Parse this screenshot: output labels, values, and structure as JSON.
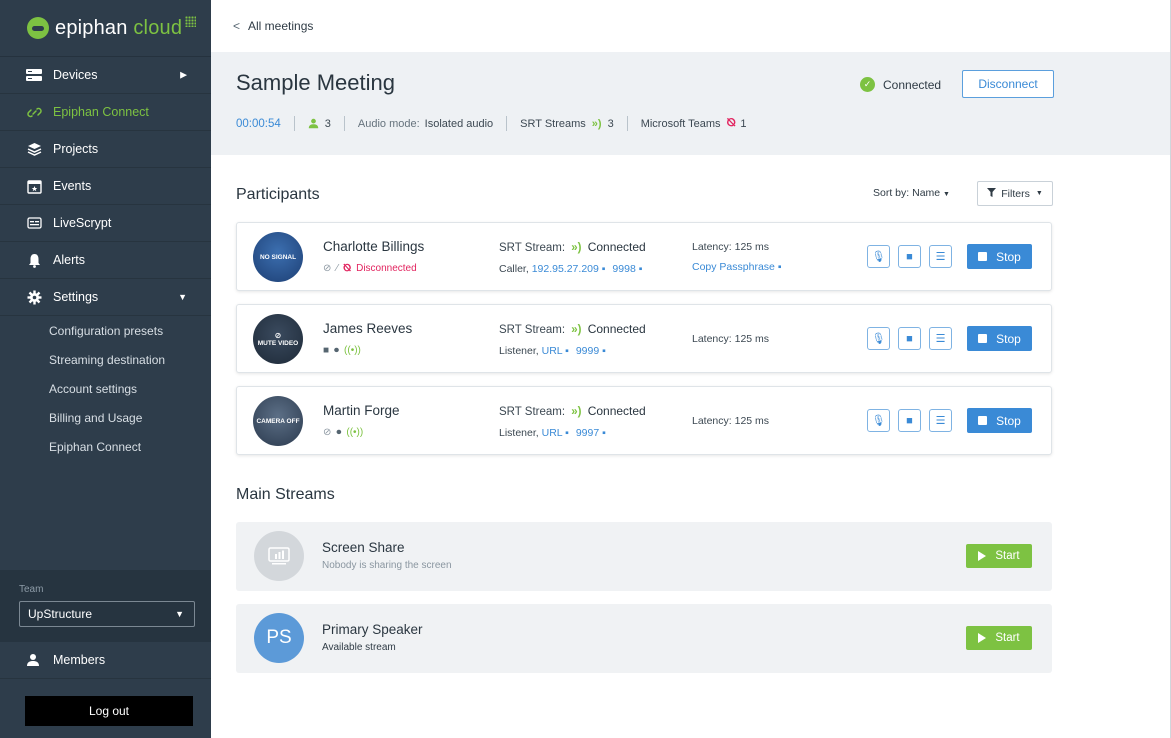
{
  "brand": {
    "name_main": "epiphan",
    "name_accent": "cloud"
  },
  "sidebar": {
    "items": [
      {
        "label": "Devices",
        "icon": "devices-icon"
      },
      {
        "label": "Epiphan Connect",
        "icon": "link-icon"
      },
      {
        "label": "Projects",
        "icon": "layers-icon"
      },
      {
        "label": "Events",
        "icon": "calendar-star-icon"
      },
      {
        "label": "LiveScrypt",
        "icon": "captions-icon"
      },
      {
        "label": "Alerts",
        "icon": "bell-icon"
      },
      {
        "label": "Settings",
        "icon": "gear-icon"
      }
    ],
    "settings_sub": [
      "Configuration presets",
      "Streaming destination",
      "Account settings",
      "Billing and Usage",
      "Epiphan Connect"
    ],
    "team_label": "Team",
    "team_value": "UpStructure",
    "members_label": "Members",
    "logout_label": "Log out"
  },
  "topbar": {
    "back_label": "All meetings"
  },
  "meeting": {
    "title": "Sample Meeting",
    "status": "Connected",
    "disconnect_label": "Disconnect",
    "timer": "00:00:54",
    "participants_count": "3",
    "audio_mode_label": "Audio mode:",
    "audio_mode_value": "Isolated audio",
    "srt_label": "SRT Streams",
    "srt_count": "3",
    "teams_label": "Microsoft Teams",
    "teams_count": "1"
  },
  "participants_section": {
    "title": "Participants",
    "sort_label": "Sort by:",
    "sort_value": "Name",
    "filters_label": "Filters"
  },
  "participants": [
    {
      "name": "Charlotte Billings",
      "avatar_text": "NO SIGNAL",
      "teams_status": "Disconnected",
      "srt_label": "SRT Stream:",
      "srt_status": "Connected",
      "mode": "Caller,",
      "address": "192.95.27.209",
      "port": "9998",
      "latency_label": "Latency:",
      "latency": "125 ms",
      "copy_passphrase": "Copy Passphrase",
      "stop_label": "Stop"
    },
    {
      "name": "James Reeves",
      "avatar_text": "MUTE VIDEO",
      "srt_label": "SRT Stream:",
      "srt_status": "Connected",
      "mode": "Listener,",
      "address": "URL",
      "port": "9999",
      "latency_label": "Latency:",
      "latency": "125 ms",
      "stop_label": "Stop"
    },
    {
      "name": "Martin Forge",
      "avatar_text": "CAMERA OFF",
      "srt_label": "SRT Stream:",
      "srt_status": "Connected",
      "mode": "Listener,",
      "address": "URL",
      "port": "9997",
      "latency_label": "Latency:",
      "latency": "125 ms",
      "stop_label": "Stop"
    }
  ],
  "main_streams": {
    "title": "Main Streams",
    "items": [
      {
        "title": "Screen Share",
        "subtitle": "Nobody is sharing the screen",
        "start_label": "Start"
      },
      {
        "title": "Primary Speaker",
        "subtitle": "Available stream",
        "avatar_text": "PS",
        "start_label": "Start"
      }
    ]
  },
  "colors": {
    "sidebar": "#2e3d4b",
    "accent_green": "#7dc242",
    "accent_blue": "#3a8ad6",
    "alert_red": "#e2245f"
  }
}
